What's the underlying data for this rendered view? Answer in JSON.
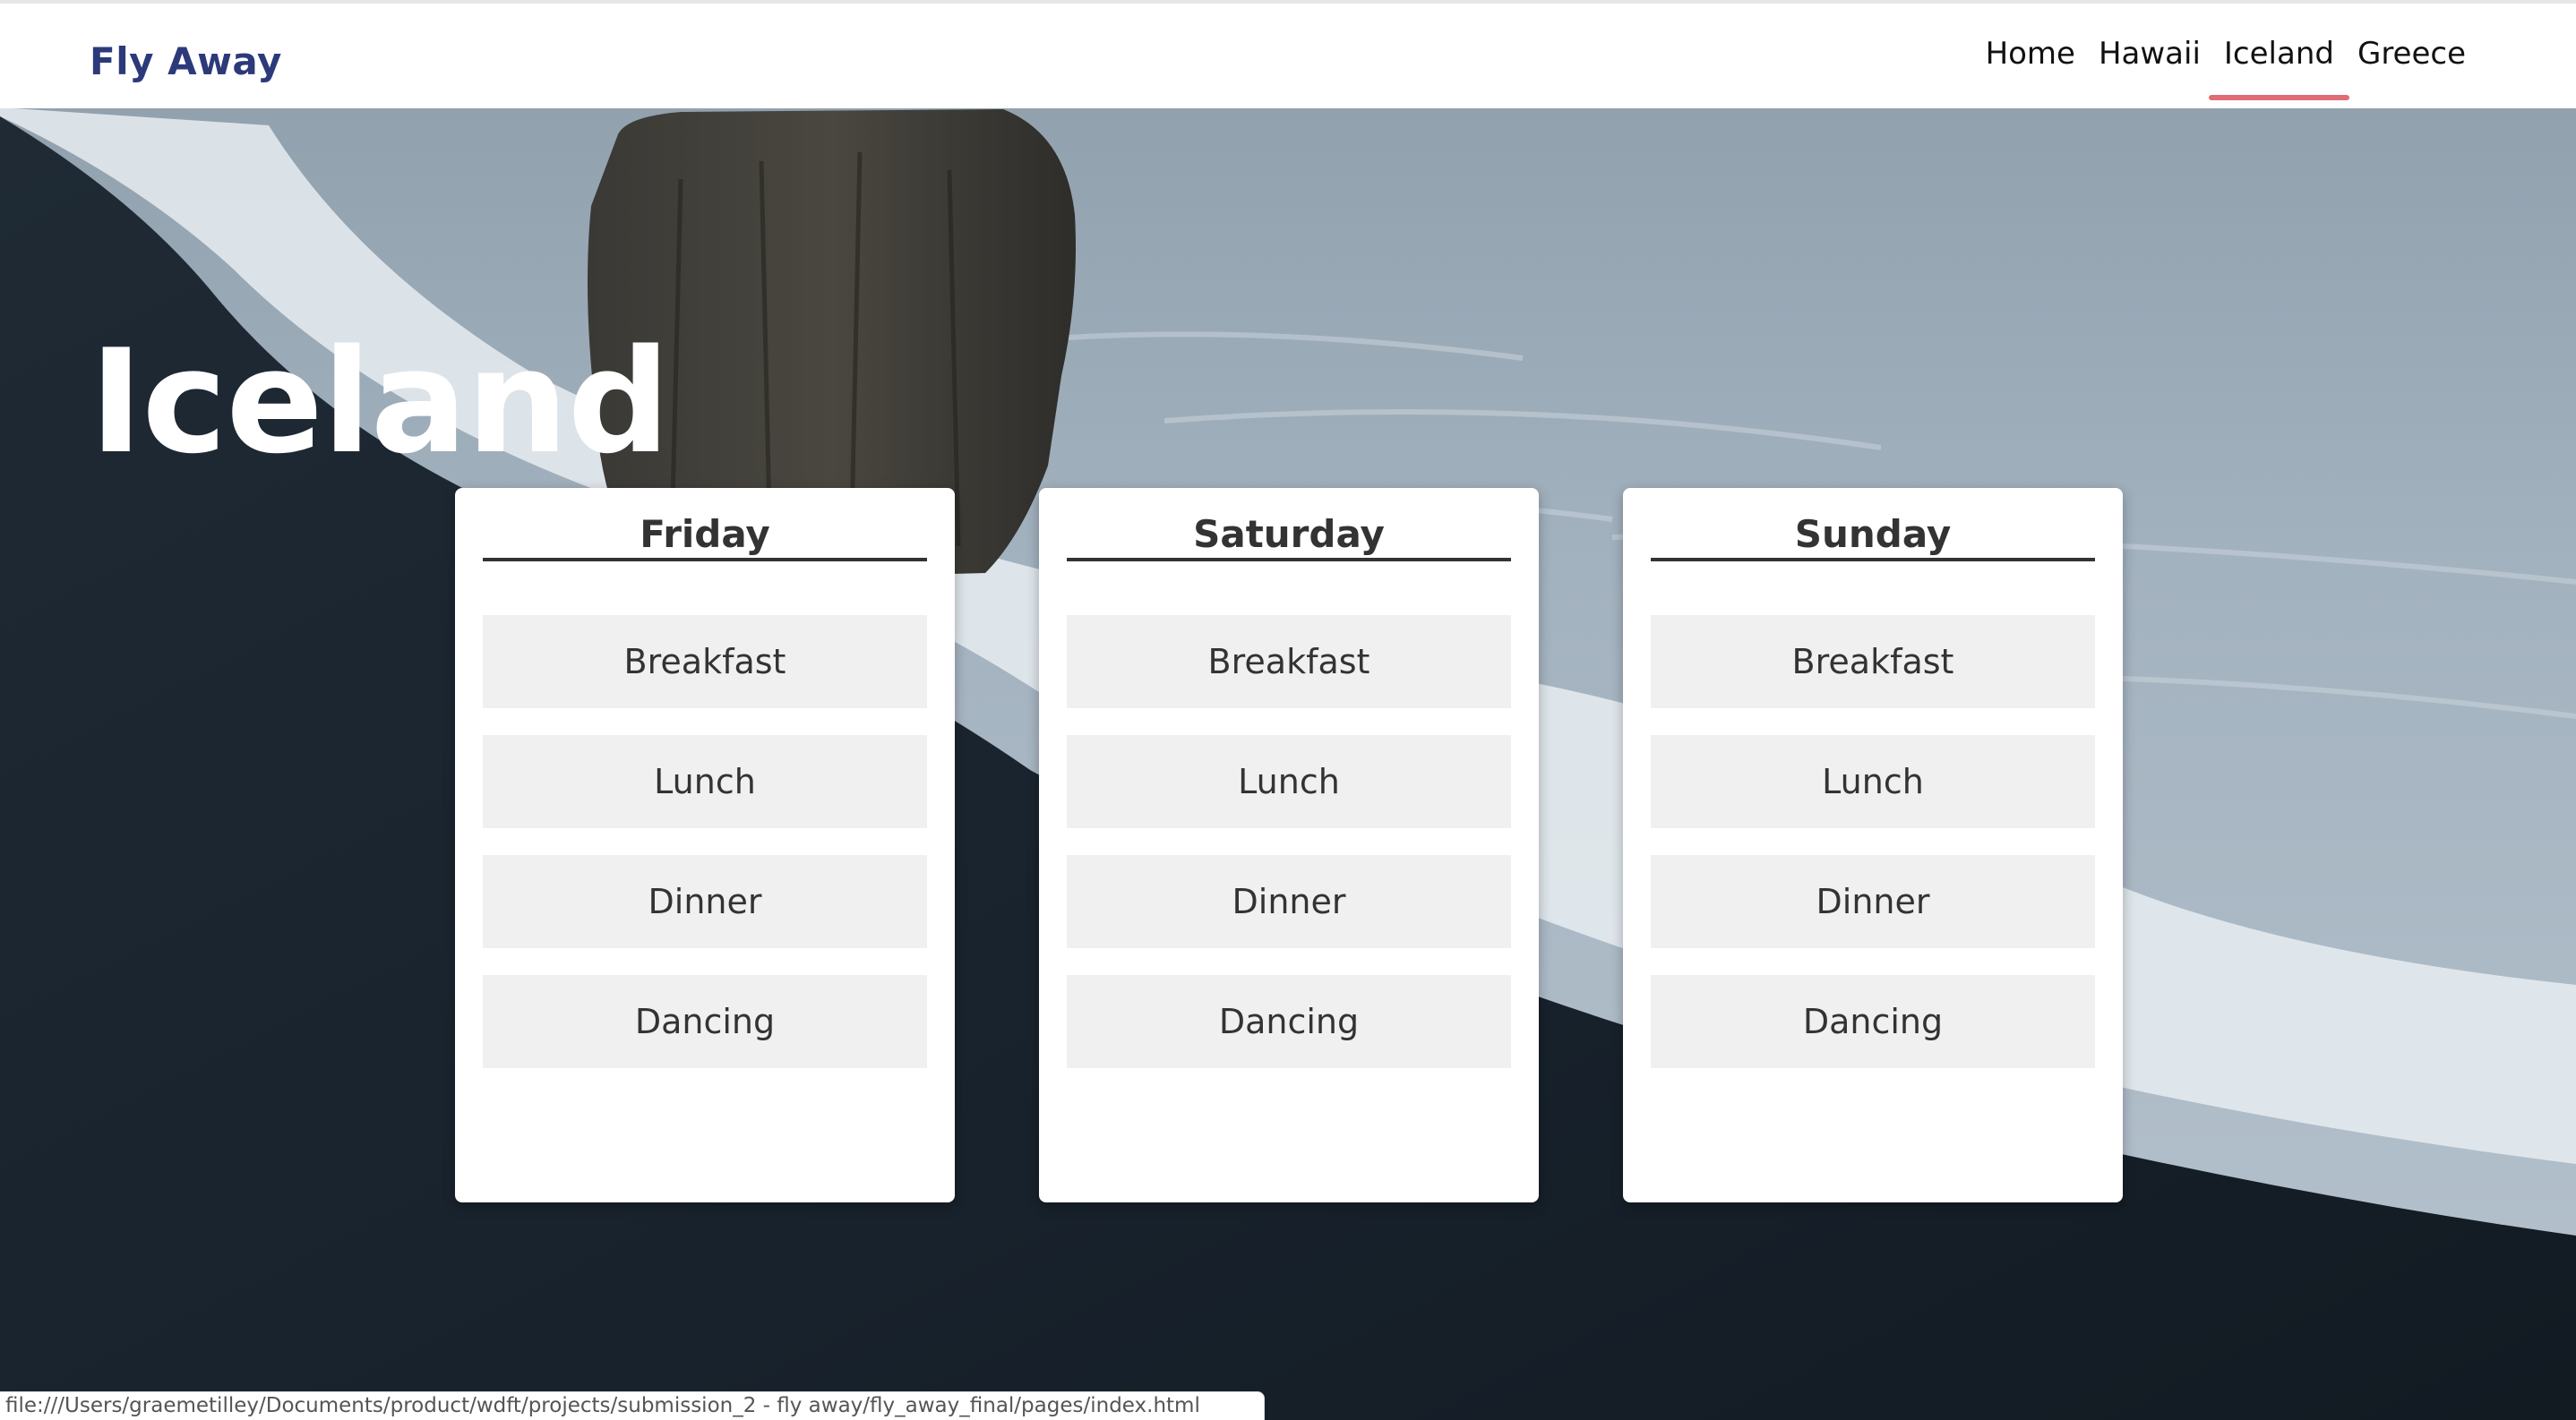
{
  "header": {
    "brand": "Fly Away",
    "nav": [
      {
        "label": "Home",
        "active": false
      },
      {
        "label": "Hawaii",
        "active": false
      },
      {
        "label": "Iceland",
        "active": true
      },
      {
        "label": "Greece",
        "active": false
      }
    ],
    "active_underline_color": "#e06c75",
    "brand_color": "#2c3a7a"
  },
  "main": {
    "title": "Iceland",
    "days": [
      {
        "name": "Friday",
        "activities": [
          "Breakfast",
          "Lunch",
          "Dinner",
          "Dancing"
        ]
      },
      {
        "name": "Saturday",
        "activities": [
          "Breakfast",
          "Lunch",
          "Dinner",
          "Dancing"
        ]
      },
      {
        "name": "Sunday",
        "activities": [
          "Breakfast",
          "Lunch",
          "Dinner",
          "Dancing"
        ]
      }
    ]
  },
  "status_bar": {
    "url": "file:///Users/graemetilley/Documents/product/wdft/projects/submission_2 - fly away/fly_away_final/pages/index.html"
  }
}
